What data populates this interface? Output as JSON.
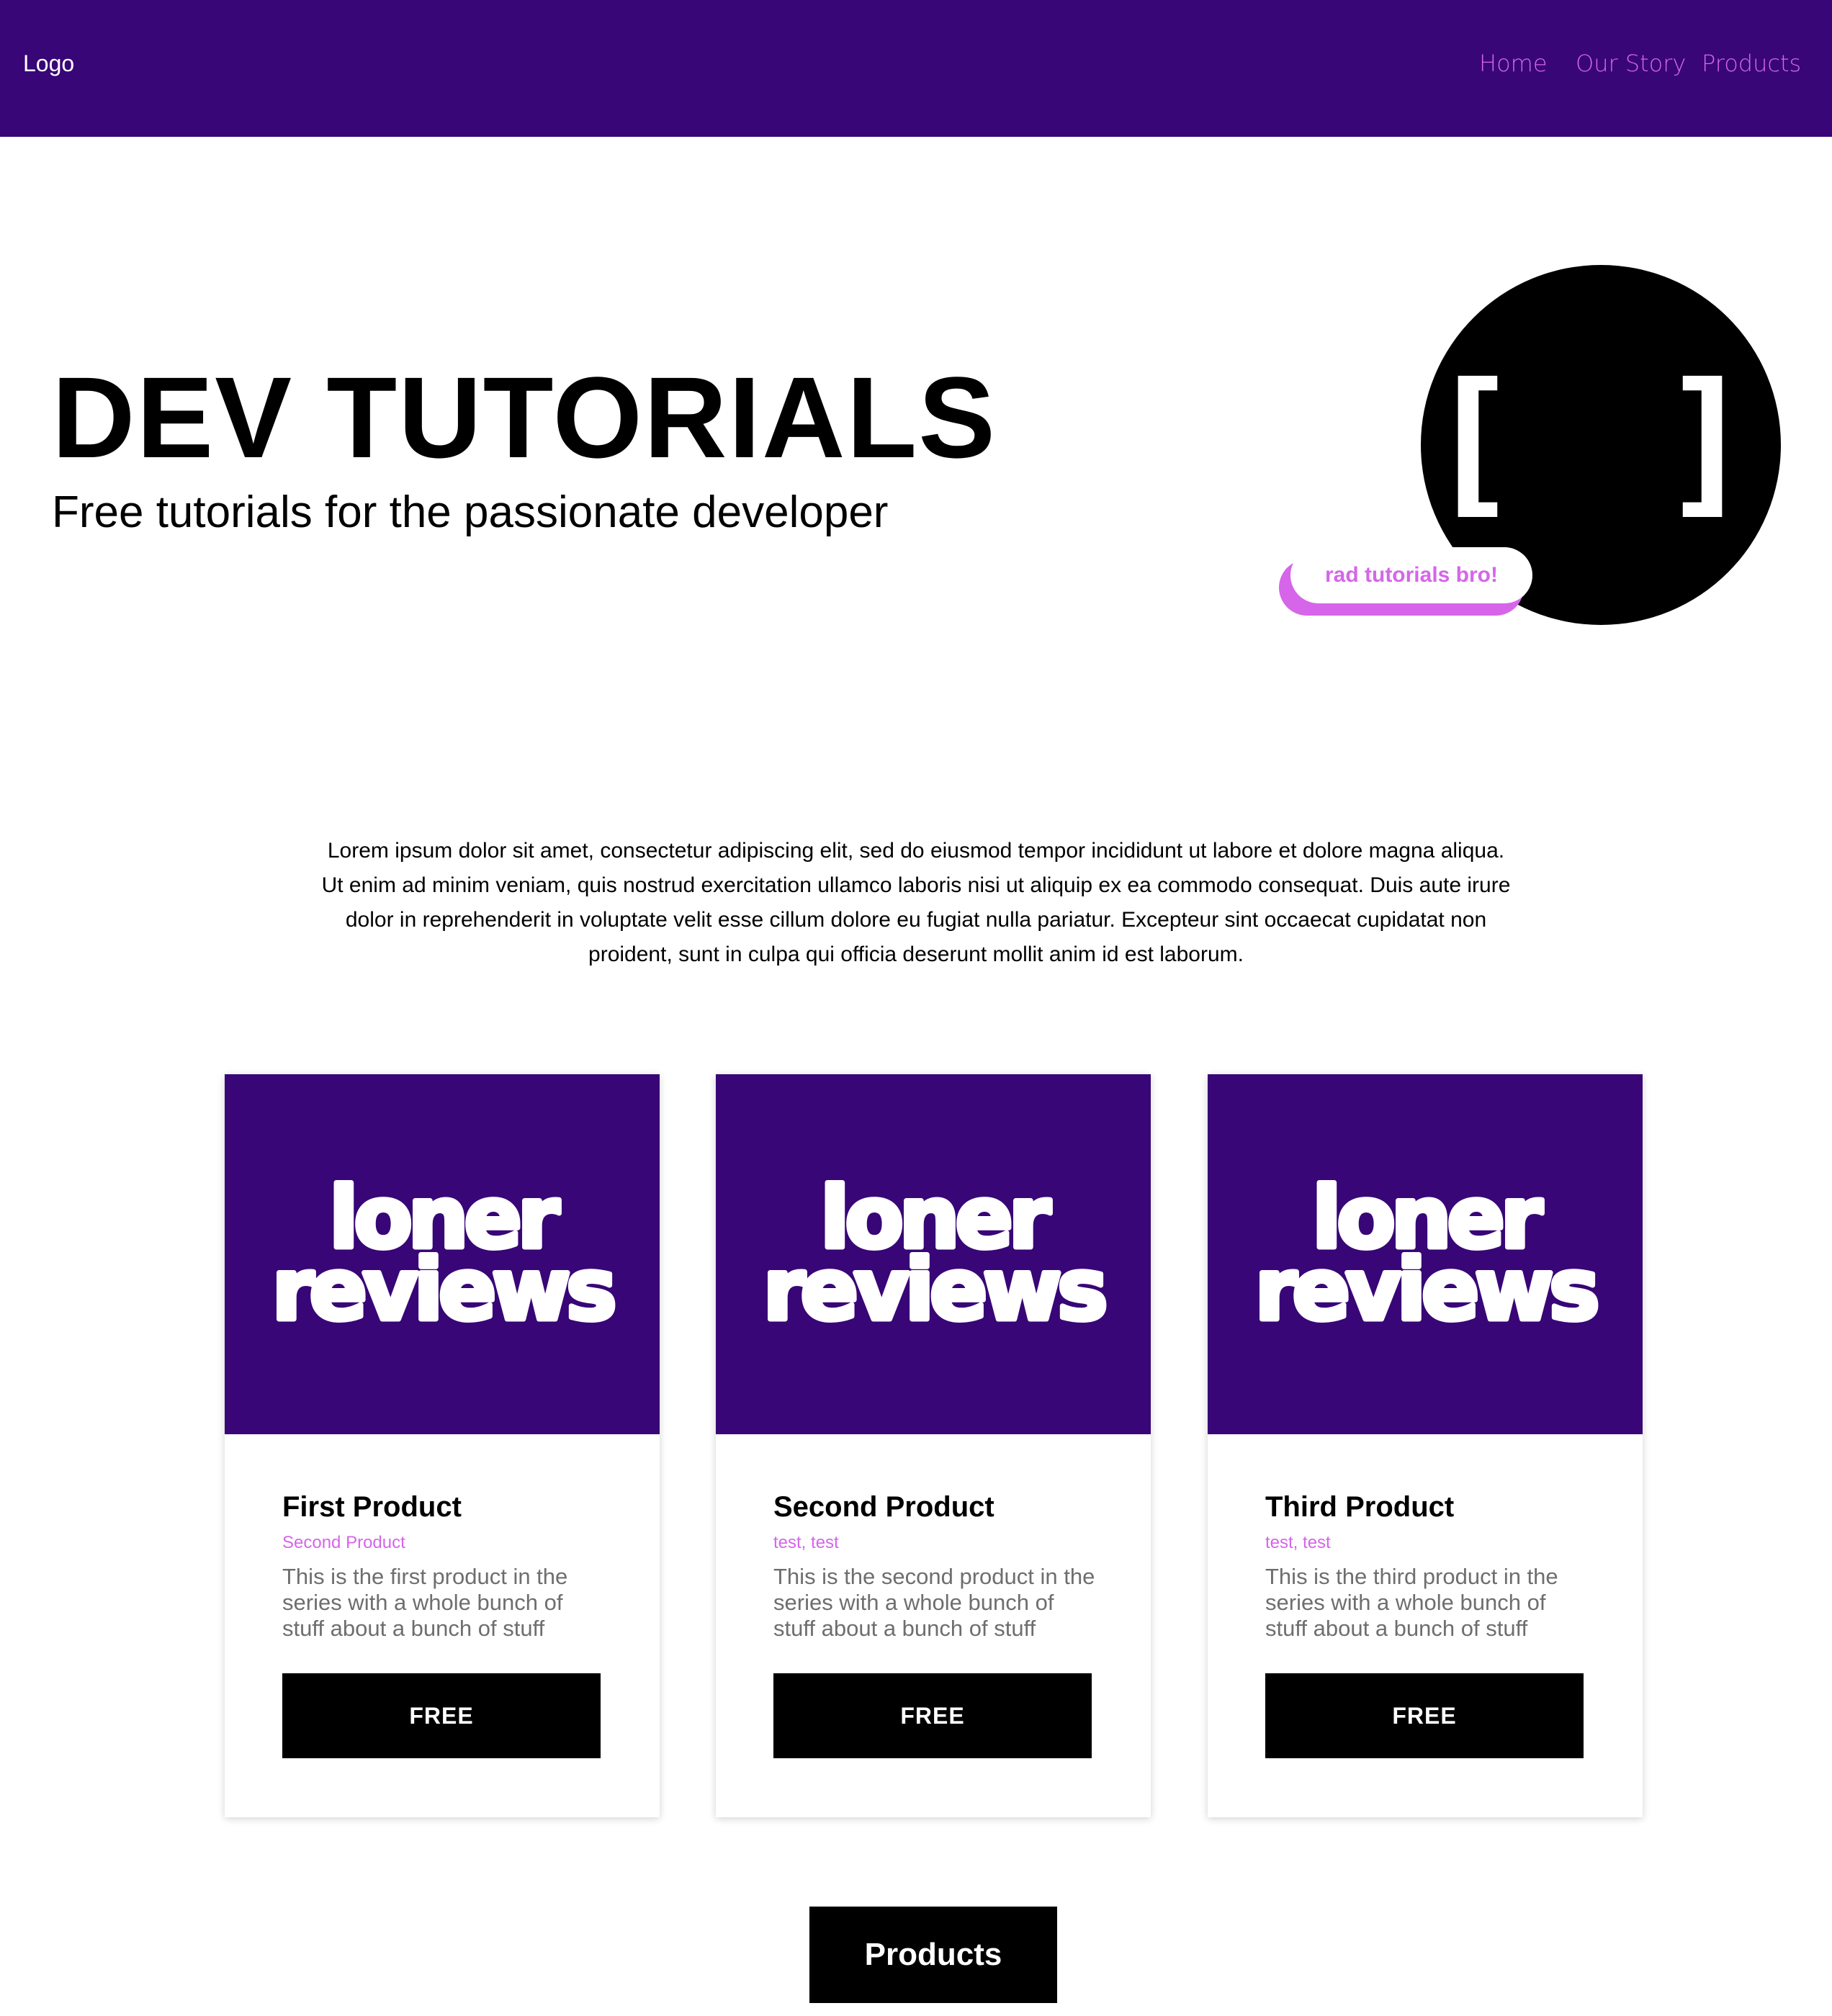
{
  "header": {
    "logo": "Logo",
    "nav": [
      {
        "label": "Home"
      },
      {
        "label": "Our Story"
      },
      {
        "label": "Products"
      }
    ]
  },
  "hero": {
    "title": "DEV TUTORIALS",
    "subtitle": "Free tutorials for the passionate developer",
    "icon_glyph": "[ ]",
    "badge": "rad tutorials bro!"
  },
  "intro": "Lorem ipsum dolor sit amet, consectetur adipiscing elit, sed do eiusmod tempor incididunt ut labore et dolore magna aliqua. Ut enim ad minim veniam, quis nostrud exercitation ullamco laboris nisi ut aliquip ex ea commodo consequat. Duis aute irure dolor in reprehenderit in voluptate velit esse cillum dolore eu fugiat nulla pariatur. Excepteur sint occaecat cupidatat non proident, sunt in culpa qui officia deserunt mollit anim id est laborum.",
  "cards": [
    {
      "image_line1": "loner",
      "image_line2": "reviews",
      "title": "First Product",
      "tags": "Second Product",
      "description": "This is the first product in the series with a whole bunch of stuff about a bunch of stuff",
      "button": "FREE"
    },
    {
      "image_line1": "loner",
      "image_line2": "reviews",
      "title": "Second Product",
      "tags": "test, test",
      "description": "This is the second product in the series with a whole bunch of stuff about a bunch of stuff",
      "button": "FREE"
    },
    {
      "image_line1": "loner",
      "image_line2": "reviews",
      "title": "Third Product",
      "tags": "test, test",
      "description": "This is the third product in the series with a whole bunch of stuff about a bunch of stuff",
      "button": "FREE"
    }
  ],
  "footer_button": "Products",
  "colors": {
    "brand_purple": "#380677",
    "accent_pink": "#d665ea",
    "text_black": "#000000",
    "muted_gray": "#6e6e6e",
    "white": "#ffffff"
  }
}
